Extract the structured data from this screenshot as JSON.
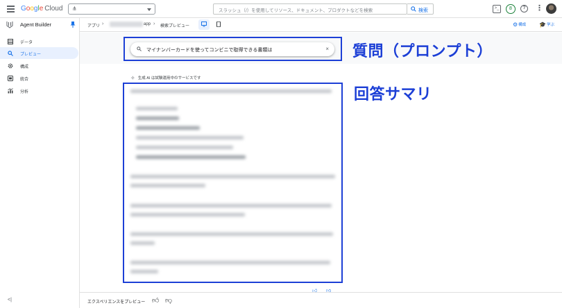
{
  "topbar": {
    "logo_google": [
      "G",
      "o",
      "o",
      "g",
      "l",
      "e"
    ],
    "logo_cloud": "Cloud",
    "search_placeholder": "スラッシュ（/）を使用してリソース、ドキュメント、プロダクトなどを検索",
    "search_button_label": "検索",
    "notification_count": "8"
  },
  "sidebar": {
    "title": "Agent Builder",
    "items": [
      {
        "label": "データ",
        "icon": "database-icon"
      },
      {
        "label": "プレビュー",
        "icon": "search-icon",
        "active": true
      },
      {
        "label": "構成",
        "icon": "gear-icon"
      },
      {
        "label": "統合",
        "icon": "integration-icon"
      },
      {
        "label": "分析",
        "icon": "analytics-icon"
      }
    ],
    "collapse_glyph": "<|"
  },
  "header": {
    "breadcrumb_apps": "アプリ",
    "breadcrumb_app_suffix": "app",
    "breadcrumb_page": "検索プレビュー",
    "action_configure": "構成",
    "action_learn": "学ぶ"
  },
  "query": {
    "text": "マイナンバーカードを使ってコンビニで取得できる書類は",
    "clear_glyph": "×"
  },
  "summary": {
    "note": "生成 AI は試験運用中のサービスです"
  },
  "annotations": {
    "question_label": "質問（プロンプト）",
    "answer_label": "回答サマリ",
    "color": "#1c3fd6"
  },
  "bottom": {
    "label": "エクスペリエンスをプレビュー"
  },
  "colors": {
    "accent": "#1a73e8",
    "active_bg": "#e8f0fe",
    "annotation": "#1c3fd6"
  }
}
